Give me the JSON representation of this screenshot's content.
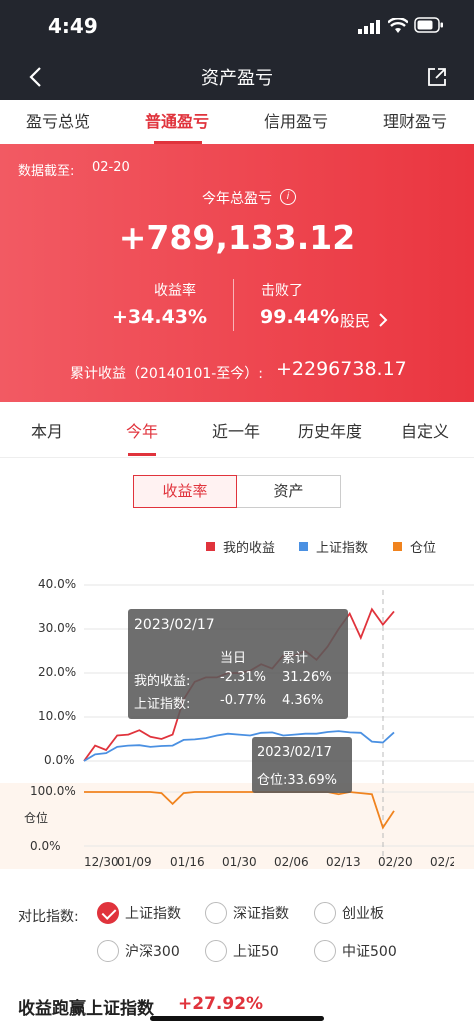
{
  "status_bar": {
    "time": "4:49"
  },
  "nav": {
    "title": "资产盈亏"
  },
  "top_tabs": [
    {
      "label": "盈亏总览"
    },
    {
      "label": "普通盈亏"
    },
    {
      "label": "信用盈亏"
    },
    {
      "label": "理财盈亏"
    }
  ],
  "summary": {
    "date_label": "数据截至:",
    "date_value": "02-20",
    "total_label": "今年总盈亏",
    "info_glyph": "i",
    "total_value": "+789,133.12",
    "yield_label": "收益率",
    "yield_value": "+34.43%",
    "beat_label": "击败了",
    "beat_value": "99.44%",
    "beat_suffix": "股民",
    "cum_label": "累计收益（20140101-至今）:",
    "cum_value": "+2296738.17"
  },
  "range_tabs": [
    {
      "label": "本月"
    },
    {
      "label": "今年"
    },
    {
      "label": "近一年"
    },
    {
      "label": "历史年度"
    },
    {
      "label": "自定义"
    }
  ],
  "segment": {
    "yield": "收益率",
    "assets": "资产"
  },
  "colors": {
    "mine": "#e0333c",
    "index": "#4a90e2",
    "position": "#f0831e"
  },
  "chart_data": {
    "type": "line",
    "legend": [
      "我的收益",
      "上证指数",
      "仓位"
    ],
    "x_ticks": [
      "12/30",
      "01/09",
      "01/16",
      "01/30",
      "02/06",
      "02/13",
      "02/20",
      "02/2"
    ],
    "y_ticks_top": [
      "40.0%",
      "30.0%",
      "20.0%",
      "10.0%",
      "0.0%"
    ],
    "y_ticks_bottom": [
      "100.0%",
      "0.0%"
    ],
    "bottom_axis_label": "仓位",
    "ylim_top": [
      0,
      40
    ],
    "ylim_bottom": [
      0,
      100
    ],
    "series": [
      {
        "name": "我的收益",
        "values": [
          0,
          3.5,
          2.5,
          5.8,
          6,
          7,
          5.5,
          5,
          6,
          14,
          18,
          19,
          19,
          20,
          20,
          20.5,
          22,
          21,
          24,
          24,
          25,
          23,
          26,
          30,
          33.5,
          28,
          34.5,
          31,
          34
        ]
      },
      {
        "name": "上证指数",
        "values": [
          0,
          1.5,
          1.8,
          3.2,
          3.5,
          3.6,
          3.2,
          3.4,
          3.5,
          4.8,
          4.9,
          5.2,
          5.8,
          6.2,
          6.0,
          5.8,
          6.4,
          6.5,
          5.8,
          6,
          6.2,
          6.2,
          6.6,
          6.8,
          6.5,
          6.4,
          4.4,
          4.2,
          6.5
        ]
      },
      {
        "name": "仓位",
        "values": [
          100,
          100,
          100,
          100,
          100,
          100,
          100,
          98,
          78,
          98,
          100,
          100,
          100,
          100,
          100,
          100,
          100,
          100,
          100,
          100,
          100,
          100,
          100,
          96,
          100,
          98,
          96,
          34,
          65
        ]
      }
    ]
  },
  "tooltip_main": {
    "date": "2023/02/17",
    "col_today": "当日",
    "col_total": "累计",
    "row1_label": "我的收益:",
    "row1_today": "-2.31%",
    "row1_total": "31.26%",
    "row2_label": "上证指数:",
    "row2_today": "-0.77%",
    "row2_total": "4.36%"
  },
  "tooltip_position": {
    "date": "2023/02/17",
    "value": "仓位:33.69%"
  },
  "compare": {
    "label": "对比指数:",
    "options": [
      "上证指数",
      "深证指数",
      "创业板",
      "沪深300",
      "上证50",
      "中证500"
    ]
  },
  "footer": {
    "label": "收益跑赢上证指数",
    "value": "+27.92%"
  }
}
